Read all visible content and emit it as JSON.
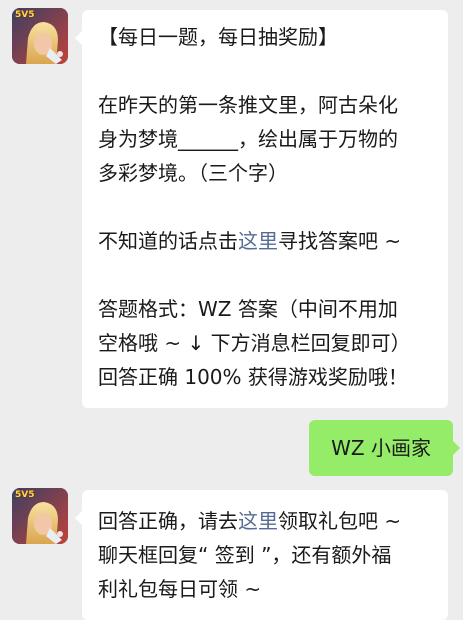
{
  "chat": {
    "messages": [
      {
        "sender": "bot",
        "title": "【每日一题，每日抽奖励】",
        "question_line1": "在昨天的第一条推文里，阿古朵化",
        "question_line2": "身为梦境______，绘出属于万物的",
        "question_line3": "多彩梦境。（三个字）",
        "hint_prefix": "不知道的话点击",
        "hint_link": "这里",
        "hint_suffix": "寻找答案吧 ~",
        "format_line1": "答题格式：WZ 答案（中间不用加",
        "format_line2": "空格哦 ~ ↓ 下方消息栏回复即可）",
        "format_line3": "回答正确 100% 获得游戏奖励哦！"
      },
      {
        "sender": "user",
        "text": "WZ 小画家"
      },
      {
        "sender": "bot",
        "reply_prefix": "回答正确，请去",
        "reply_link": "这里",
        "reply_suffix": "领取礼包吧 ~",
        "reply_line2": "聊天框回复“ 签到 ”，还有额外福",
        "reply_line3": "利礼包每日可领 ~"
      }
    ],
    "avatar_badge": "5V5"
  }
}
